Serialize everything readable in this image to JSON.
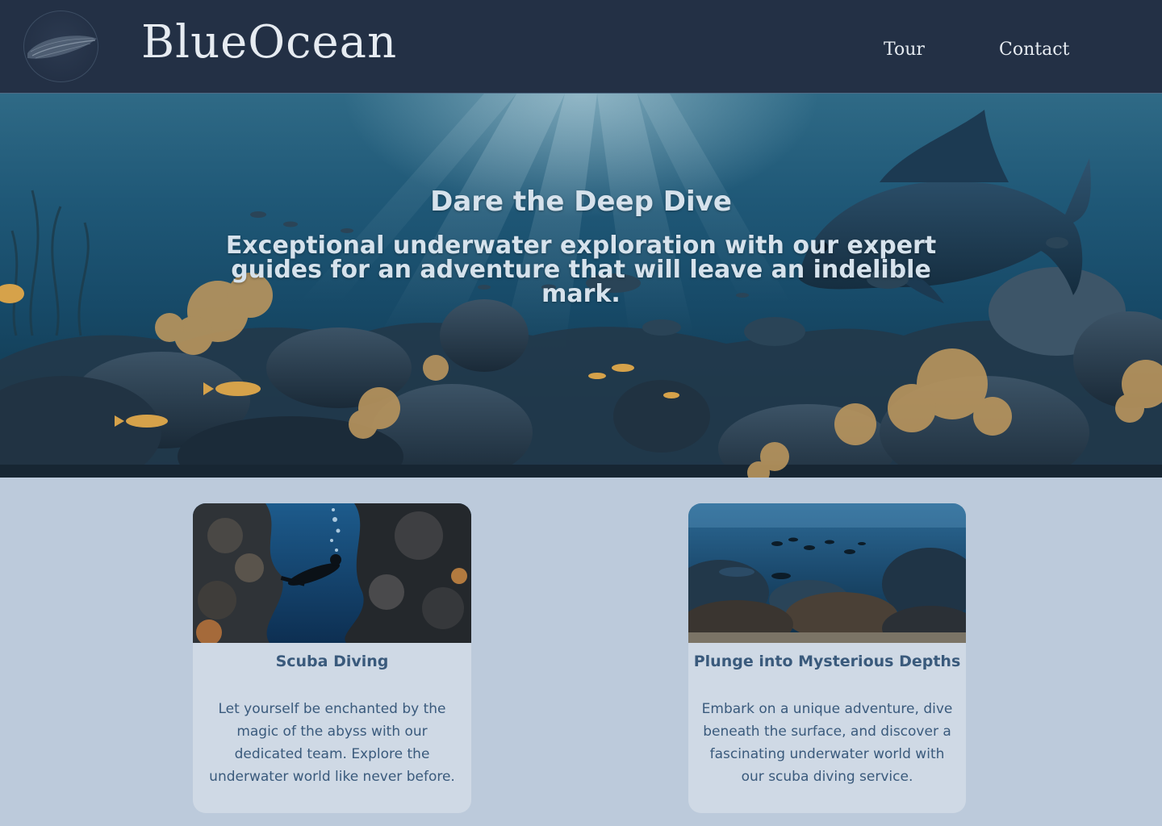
{
  "header": {
    "brand": "BlueOcean",
    "logo_icon": "fish-icon",
    "nav": [
      {
        "label": "Tour"
      },
      {
        "label": "Contact"
      }
    ]
  },
  "hero": {
    "title": "Dare the Deep Dive",
    "subtitle": "Exceptional underwater exploration with our expert guides for an adventure that will leave an indelible mark."
  },
  "cards": [
    {
      "title": "Scuba Diving",
      "text": "Let yourself be enchanted by the magic of the abyss with our dedicated team. Explore the underwater world like never before."
    },
    {
      "title": "Plunge into Mysterious Depths",
      "text": "Embark on a unique adventure, dive beneath the surface, and discover a fascinating underwater world with our scuba diving service."
    }
  ],
  "colors": {
    "header_bg": "#233045",
    "page_bg": "#bccadb",
    "card_bg": "#cfd9e5",
    "card_text": "#3a5a7c",
    "hero_text": "#d6e2ec"
  }
}
